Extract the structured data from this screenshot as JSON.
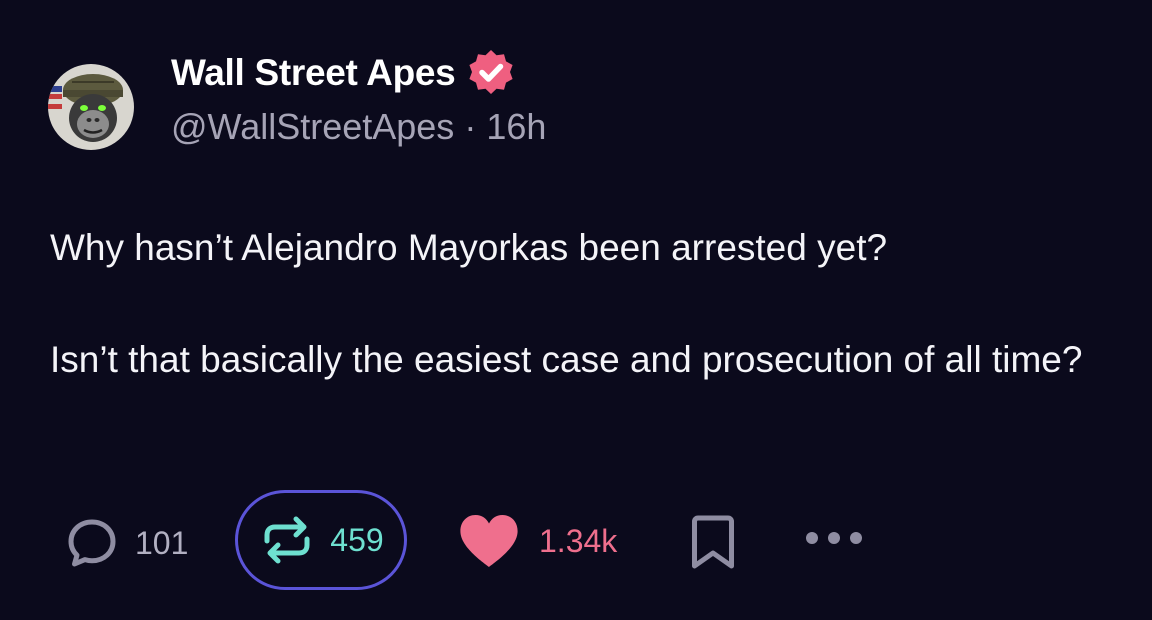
{
  "post": {
    "author": {
      "display_name": "Wall Street Apes",
      "handle": "@WallStreetApes",
      "separator": "·",
      "time_ago": "16h",
      "verified": true,
      "avatar_icon": "helmeted-gorilla-avatar"
    },
    "paragraphs": [
      "Why hasn’t Alejandro Mayorkas been arrested yet?",
      "Isn’t that basically the easiest case and prosecution of all time?"
    ],
    "actions": {
      "reply": {
        "icon": "reply-bubble-icon",
        "count": "101"
      },
      "repost": {
        "icon": "repost-arrows-icon",
        "count": "459",
        "active": true
      },
      "like": {
        "icon": "heart-icon",
        "count": "1.34k",
        "active": true
      },
      "bookmark": {
        "icon": "bookmark-icon"
      },
      "more": {
        "icon": "more-dots-icon"
      }
    }
  },
  "colors": {
    "background": "#0b0a1c",
    "text": "#f4f4f8",
    "muted": "#a6a4b6",
    "verified_badge": "#ef5f80",
    "repost_accent": "#6ee0d0",
    "repost_ring": "#5b54d8",
    "like_accent": "#ef6f8d"
  }
}
